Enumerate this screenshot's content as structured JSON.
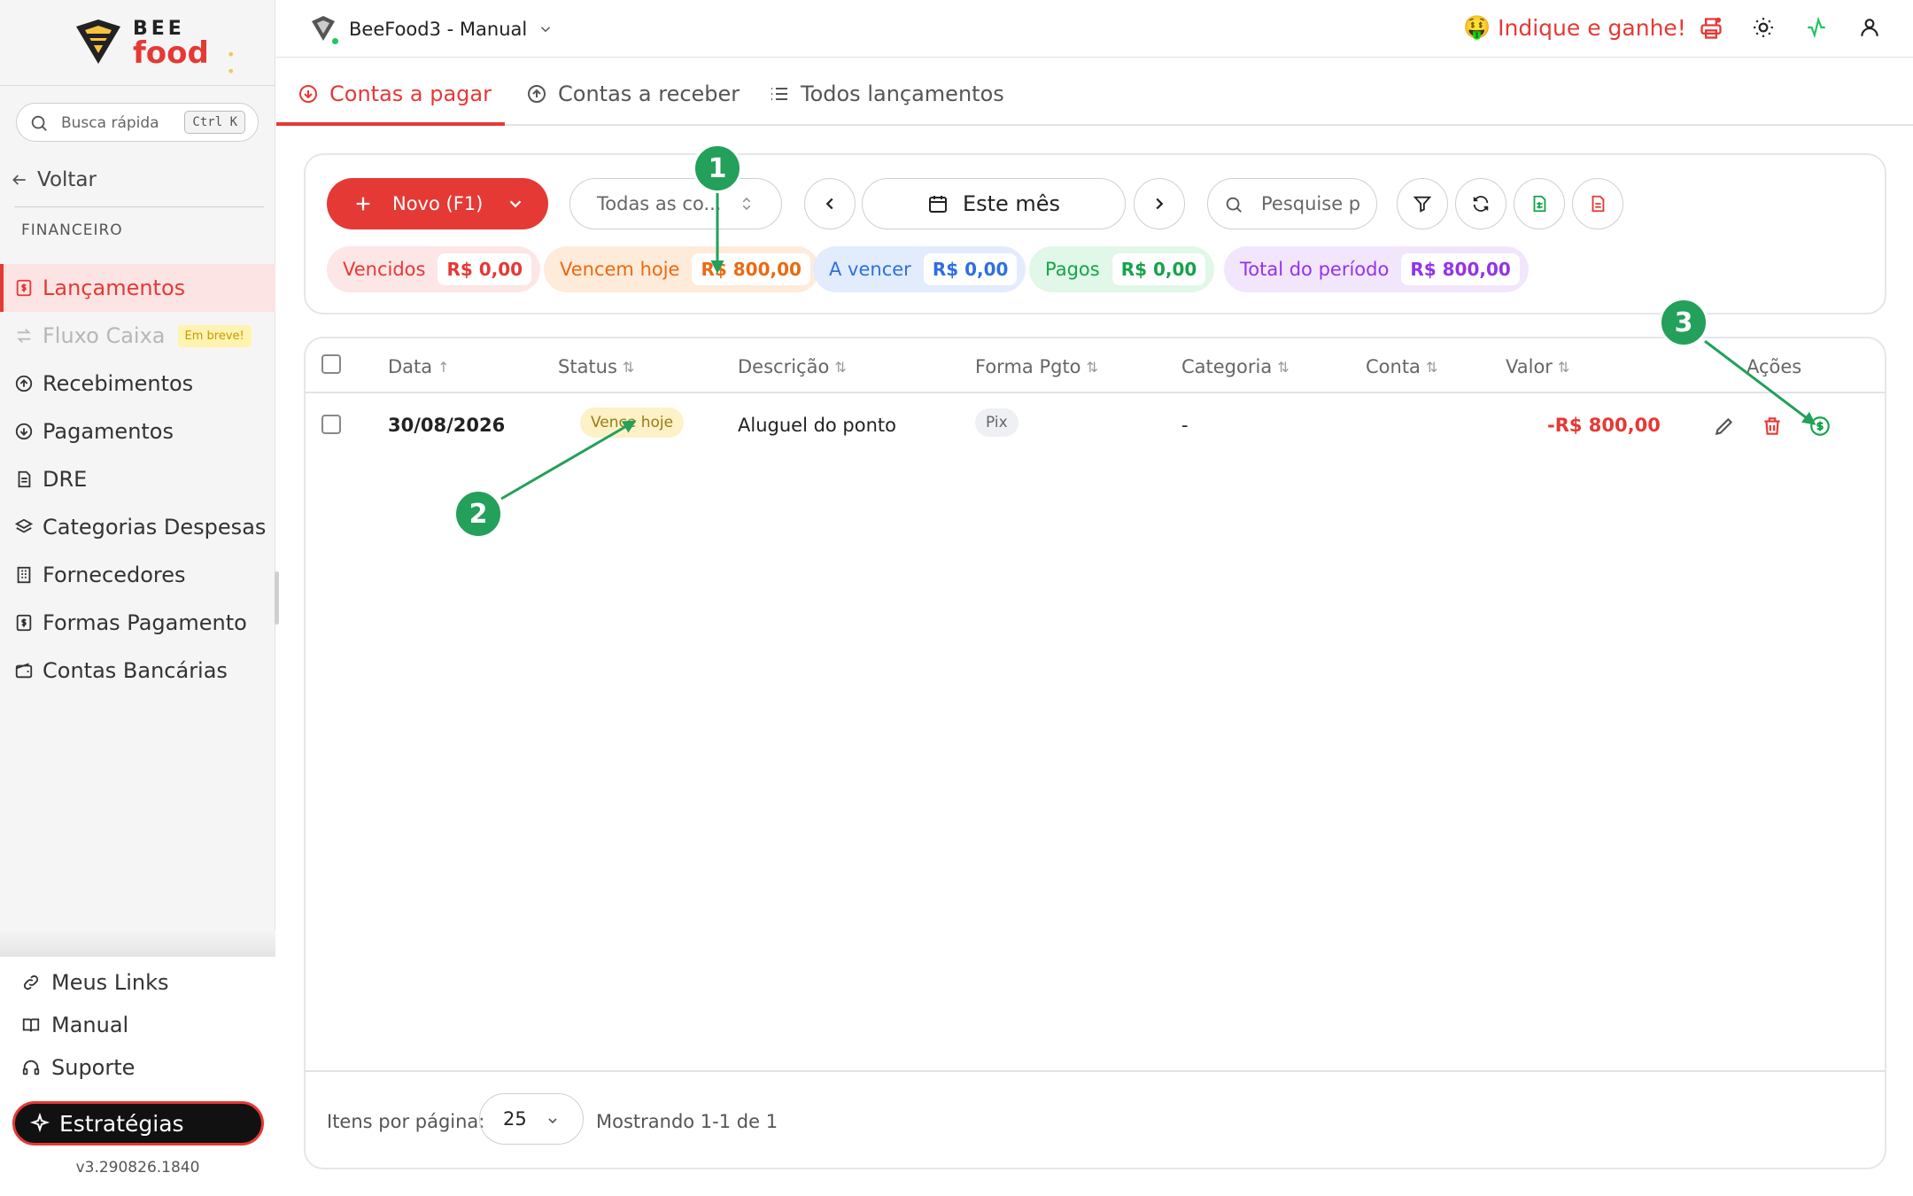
{
  "brand": {
    "logo_top": "BEE",
    "logo_bottom": "food"
  },
  "sidebar": {
    "search": {
      "placeholder": "Busca rápida",
      "shortcut": "Ctrl K"
    },
    "back_label": "Voltar",
    "section_label": "FINANCEIRO",
    "items": [
      {
        "label": "Lançamentos",
        "icon": "dollar-doc-icon",
        "active": true
      },
      {
        "label": "Fluxo Caixa",
        "icon": "arrows-swap-icon",
        "disabled": true,
        "badge": "Em breve!"
      },
      {
        "label": "Recebimentos",
        "icon": "arrow-up-circle-icon"
      },
      {
        "label": "Pagamentos",
        "icon": "arrow-down-circle-icon"
      },
      {
        "label": "DRE",
        "icon": "document-icon"
      },
      {
        "label": "Categorias Despesas",
        "icon": "layers-icon"
      },
      {
        "label": "Fornecedores",
        "icon": "building-icon"
      },
      {
        "label": "Formas Pagamento",
        "icon": "dollar-doc-icon"
      },
      {
        "label": "Contas Bancárias",
        "icon": "wallet-icon"
      }
    ],
    "bottom_links": [
      {
        "label": "Meus Links",
        "icon": "link-icon"
      },
      {
        "label": "Manual",
        "icon": "book-icon"
      },
      {
        "label": "Suporte",
        "icon": "headset-icon"
      }
    ],
    "strategy_button": "Estratégias",
    "version": "v3.290826.1840"
  },
  "topbar": {
    "store_name": "BeeFood3 - Manual",
    "refer_label": "Indique e ganhe!",
    "refer_emoji": "🤑",
    "icons": [
      "printer-icon",
      "sun-icon",
      "activity-icon",
      "user-icon"
    ]
  },
  "tabs": [
    {
      "label": "Contas a pagar",
      "active": true
    },
    {
      "label": "Contas a receber"
    },
    {
      "label": "Todos lançamentos"
    }
  ],
  "toolbar": {
    "new_button": "Novo (F1)",
    "account_select": "Todas as co...",
    "period": "Este mês",
    "search_placeholder": "Pesquise p"
  },
  "summary": [
    {
      "label": "Vencidos",
      "value": "R$ 0,00",
      "color": "#e53935",
      "bg": "#fde6e6"
    },
    {
      "label": "Vencem hoje",
      "value": "R$ 800,00",
      "color": "#ea6a12",
      "bg": "#feebd9"
    },
    {
      "label": "A vencer",
      "value": "R$ 0,00",
      "color": "#2f6fdf",
      "bg": "#e2ecfd"
    },
    {
      "label": "Pagos",
      "value": "R$ 0,00",
      "color": "#16a34a",
      "bg": "#e1f7e7"
    },
    {
      "label": "Total do período",
      "value": "R$ 800,00",
      "color": "#9333ea",
      "bg": "#f2e6fd"
    }
  ],
  "table": {
    "columns": [
      "Data",
      "Status",
      "Descrição",
      "Forma Pgto",
      "Categoria",
      "Conta",
      "Valor",
      "Ações"
    ],
    "rows": [
      {
        "date": "30/08/2026",
        "status": "Vence hoje",
        "description": "Aluguel do ponto",
        "payment": "Pix",
        "category": "-",
        "account": "",
        "value": "-R$ 800,00"
      }
    ],
    "per_page_label": "Itens por página:",
    "per_page": "25",
    "showing": "Mostrando 1-1 de 1"
  },
  "annotations": [
    "1",
    "2",
    "3"
  ],
  "colors": {
    "accent": "#e53935",
    "annotation": "#23a05a"
  }
}
